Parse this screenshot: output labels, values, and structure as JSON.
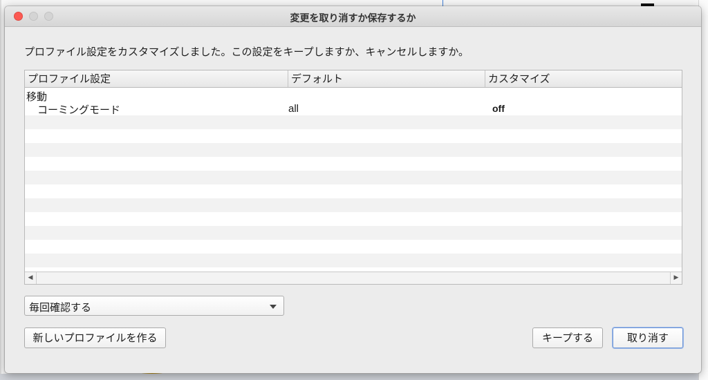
{
  "dialog": {
    "title": "変更を取り消すか保存するか",
    "message": "プロファイル設定をカスタマイズしました。この設定をキープしますか、キャンセルしますか。"
  },
  "table": {
    "columns": [
      "プロファイル設定",
      "デフォルト",
      "カスタマイズ"
    ],
    "group": "移動",
    "rows": [
      {
        "setting": "コーミングモード",
        "default": "all",
        "custom": "off"
      }
    ]
  },
  "dropdown": {
    "selected": "毎回確認する"
  },
  "buttons": {
    "new_profile": "新しいプロファイルを作る",
    "keep": "キープする",
    "discard": "取り消す"
  },
  "colors": {
    "close_button": "#fc5a53",
    "default_button_focus": "#6d95d6",
    "row_stripe": "#f2f2f2"
  }
}
